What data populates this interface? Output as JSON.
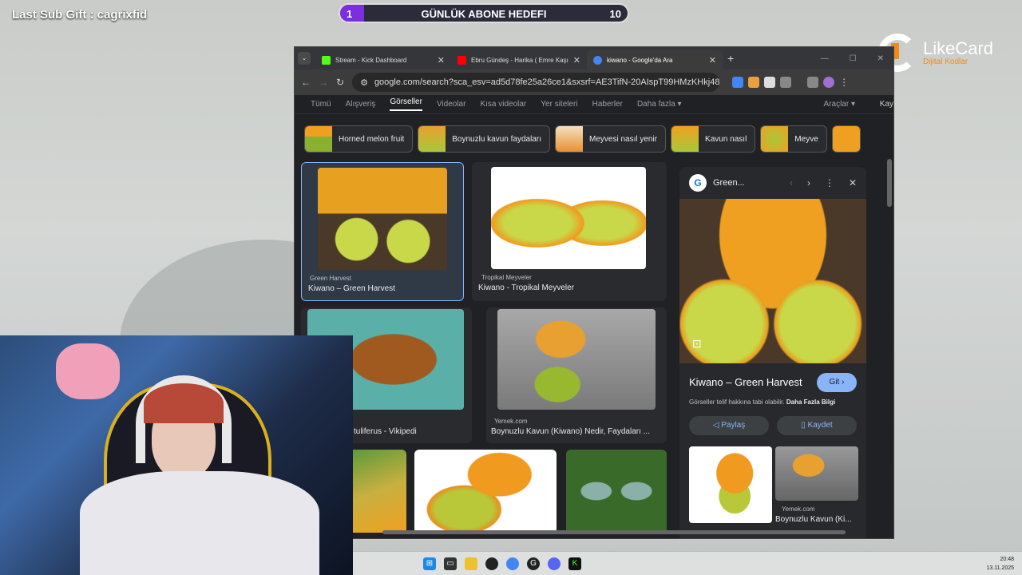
{
  "overlay": {
    "last_sub_gift": "Last Sub Gift : cagrixfid",
    "goal": {
      "title": "GÜNLÜK ABONE HEDEFI",
      "current": "1",
      "target": "10"
    },
    "sponsor": {
      "name": "LikeCard",
      "tagline": "Dijital Kodlar"
    }
  },
  "browser": {
    "tabs": [
      {
        "title": "Stream - Kick Dashboard",
        "favicon_color": "#53fc18"
      },
      {
        "title": "Ebru Gündeş - Harika ( Emre Kaşık...",
        "favicon_color": "#ff0000"
      },
      {
        "title": "kiwano - Google'da Ara",
        "favicon_color": "#4285f4"
      }
    ],
    "url": "google.com/search?sca_esv=ad5d78fe25a26ce1&sxsrf=AE3TifN-20AIspT99HMzKHkj48ZcE..."
  },
  "google": {
    "nav": [
      "Tümü",
      "Alışveriş",
      "Görseller",
      "Videolar",
      "Kısa videolar",
      "Yer siteleri",
      "Haberler",
      "Daha fazla ▾"
    ],
    "tools": "Araçlar ▾",
    "saved": "Kay",
    "chips": [
      "Horned melon fruit",
      "Boynuzlu kavun faydaları",
      "Meyvesi nasıl yenir",
      "Kavun nasıl",
      "Meyve",
      ""
    ],
    "results": [
      {
        "source": "Green Harvest",
        "caption": "Kiwano – Green Harvest"
      },
      {
        "source": "Tropikal Meyveler",
        "caption": "Kiwano - Tropikal Meyveler"
      },
      {
        "source": "",
        "caption": "tuliferus - Vikipedi"
      },
      {
        "source": "Yemek.com",
        "caption": "Boynuzlu Kavun (Kiwano) Nedir, Faydaları ..."
      }
    ],
    "panel": {
      "site": "Green...",
      "title": "Kiwano – Green Harvest",
      "visit": "Git ›",
      "note": "Görseller telif hakkına tabi olabilir.",
      "more": "Daha Fazla Bilgi",
      "share": "Paylaş",
      "save": "Kaydet",
      "related_source": "Yemek.com",
      "related_caption": "Boynuzlu Kavun (Ki..."
    }
  },
  "taskbar": {
    "time": "20:48",
    "date": "13.11.2025"
  },
  "colors": {
    "accent": "#8ab4f8",
    "goal_fill": "#7b2fe0",
    "fruit": "#f0a020",
    "flesh": "#a8c83a"
  }
}
